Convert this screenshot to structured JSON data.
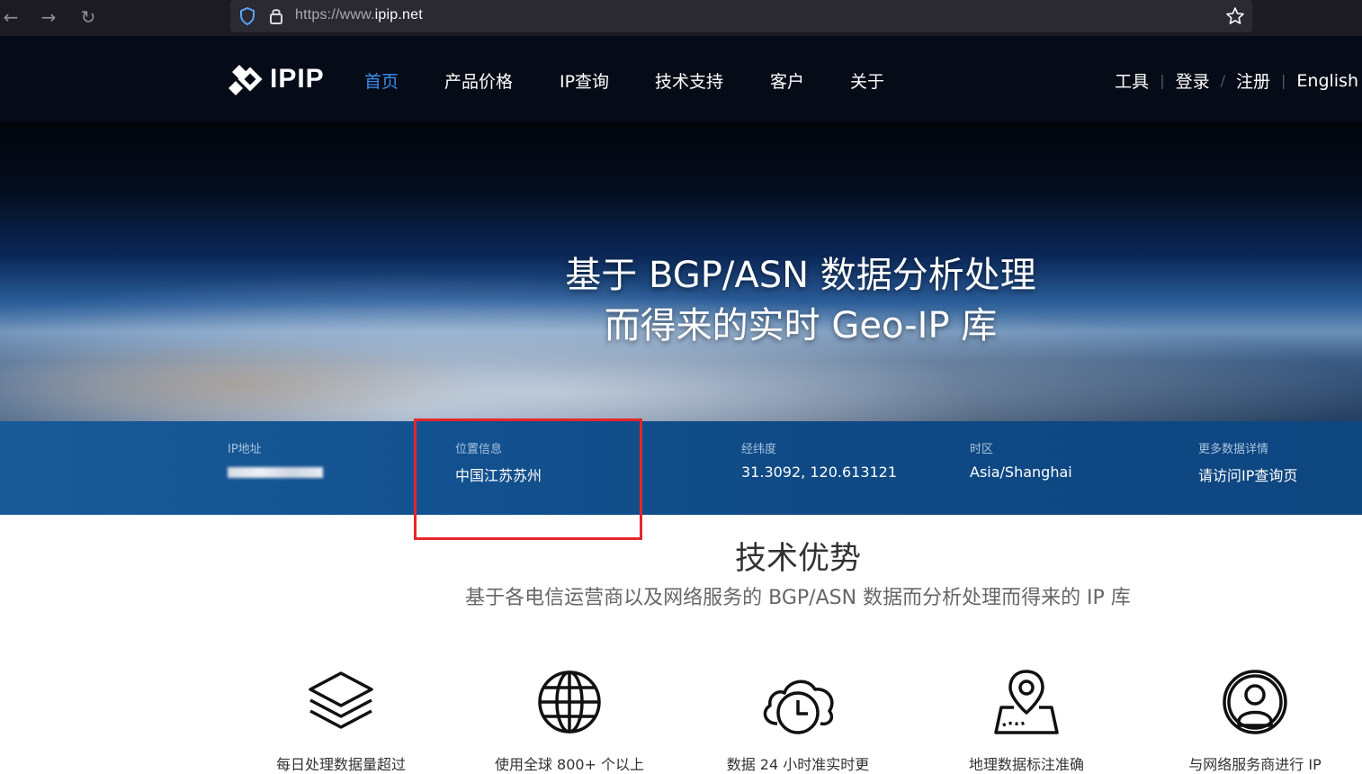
{
  "browser": {
    "url_prefix": "https://www.",
    "url_domain": "ipip.net",
    "back_icon": "arrow-left-icon",
    "forward_icon": "arrow-right-icon",
    "reload_icon": "reload-icon"
  },
  "header": {
    "logo_text": "IPIP",
    "nav": [
      "首页",
      "产品价格",
      "IP查询",
      "技术支持",
      "客户",
      "关于"
    ],
    "active_nav": "首页",
    "right_nav": {
      "tools": "工具",
      "login": "登录",
      "register": "注册",
      "english": "English"
    }
  },
  "hero": {
    "line1": "基于 BGP/ASN 数据分析处理",
    "line2": "而得来的实时 Geo-IP 库"
  },
  "info": {
    "ip": {
      "label": "IP地址",
      "value": ""
    },
    "location": {
      "label": "位置信息",
      "value": "中国江苏苏州"
    },
    "coords": {
      "label": "经纬度",
      "value": "31.3092, 120.613121"
    },
    "timezone": {
      "label": "时区",
      "value": "Asia/Shanghai"
    },
    "more": {
      "label": "更多数据详情",
      "value": "请访问IP查询页"
    }
  },
  "section": {
    "title": "技术优势",
    "subtitle": "基于各电信运营商以及网络服务的 BGP/ASN 数据而分析处理而得来的 IP 库"
  },
  "features": [
    {
      "icon": "layers-icon",
      "label": "每日处理数据量超过"
    },
    {
      "icon": "globe-icon",
      "label": "使用全球 800+ 个以上"
    },
    {
      "icon": "cloud-clock-icon",
      "label": "数据 24 小时准实时更"
    },
    {
      "icon": "map-pin-icon",
      "label": "地理数据标注准确"
    },
    {
      "icon": "user-circle-icon",
      "label": "与网络服务商进行 IP"
    }
  ],
  "colors": {
    "highlight": "#e5262b",
    "active_nav": "#3d8ef0",
    "info_bar": "#135290"
  }
}
